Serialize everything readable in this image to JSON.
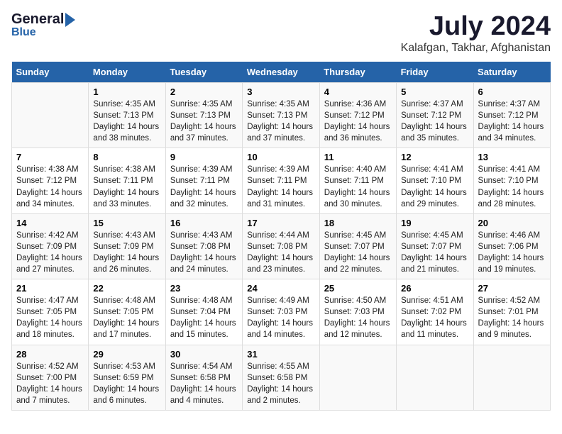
{
  "header": {
    "logo_general": "General",
    "logo_blue": "Blue",
    "title": "July 2024",
    "subtitle": "Kalafgan, Takhar, Afghanistan"
  },
  "days_of_week": [
    "Sunday",
    "Monday",
    "Tuesday",
    "Wednesday",
    "Thursday",
    "Friday",
    "Saturday"
  ],
  "weeks": [
    [
      {
        "day": "",
        "content": ""
      },
      {
        "day": "1",
        "content": "Sunrise: 4:35 AM\nSunset: 7:13 PM\nDaylight: 14 hours\nand 38 minutes."
      },
      {
        "day": "2",
        "content": "Sunrise: 4:35 AM\nSunset: 7:13 PM\nDaylight: 14 hours\nand 37 minutes."
      },
      {
        "day": "3",
        "content": "Sunrise: 4:35 AM\nSunset: 7:13 PM\nDaylight: 14 hours\nand 37 minutes."
      },
      {
        "day": "4",
        "content": "Sunrise: 4:36 AM\nSunset: 7:12 PM\nDaylight: 14 hours\nand 36 minutes."
      },
      {
        "day": "5",
        "content": "Sunrise: 4:37 AM\nSunset: 7:12 PM\nDaylight: 14 hours\nand 35 minutes."
      },
      {
        "day": "6",
        "content": "Sunrise: 4:37 AM\nSunset: 7:12 PM\nDaylight: 14 hours\nand 34 minutes."
      }
    ],
    [
      {
        "day": "7",
        "content": "Sunrise: 4:38 AM\nSunset: 7:12 PM\nDaylight: 14 hours\nand 34 minutes."
      },
      {
        "day": "8",
        "content": "Sunrise: 4:38 AM\nSunset: 7:11 PM\nDaylight: 14 hours\nand 33 minutes."
      },
      {
        "day": "9",
        "content": "Sunrise: 4:39 AM\nSunset: 7:11 PM\nDaylight: 14 hours\nand 32 minutes."
      },
      {
        "day": "10",
        "content": "Sunrise: 4:39 AM\nSunset: 7:11 PM\nDaylight: 14 hours\nand 31 minutes."
      },
      {
        "day": "11",
        "content": "Sunrise: 4:40 AM\nSunset: 7:11 PM\nDaylight: 14 hours\nand 30 minutes."
      },
      {
        "day": "12",
        "content": "Sunrise: 4:41 AM\nSunset: 7:10 PM\nDaylight: 14 hours\nand 29 minutes."
      },
      {
        "day": "13",
        "content": "Sunrise: 4:41 AM\nSunset: 7:10 PM\nDaylight: 14 hours\nand 28 minutes."
      }
    ],
    [
      {
        "day": "14",
        "content": "Sunrise: 4:42 AM\nSunset: 7:09 PM\nDaylight: 14 hours\nand 27 minutes."
      },
      {
        "day": "15",
        "content": "Sunrise: 4:43 AM\nSunset: 7:09 PM\nDaylight: 14 hours\nand 26 minutes."
      },
      {
        "day": "16",
        "content": "Sunrise: 4:43 AM\nSunset: 7:08 PM\nDaylight: 14 hours\nand 24 minutes."
      },
      {
        "day": "17",
        "content": "Sunrise: 4:44 AM\nSunset: 7:08 PM\nDaylight: 14 hours\nand 23 minutes."
      },
      {
        "day": "18",
        "content": "Sunrise: 4:45 AM\nSunset: 7:07 PM\nDaylight: 14 hours\nand 22 minutes."
      },
      {
        "day": "19",
        "content": "Sunrise: 4:45 AM\nSunset: 7:07 PM\nDaylight: 14 hours\nand 21 minutes."
      },
      {
        "day": "20",
        "content": "Sunrise: 4:46 AM\nSunset: 7:06 PM\nDaylight: 14 hours\nand 19 minutes."
      }
    ],
    [
      {
        "day": "21",
        "content": "Sunrise: 4:47 AM\nSunset: 7:05 PM\nDaylight: 14 hours\nand 18 minutes."
      },
      {
        "day": "22",
        "content": "Sunrise: 4:48 AM\nSunset: 7:05 PM\nDaylight: 14 hours\nand 17 minutes."
      },
      {
        "day": "23",
        "content": "Sunrise: 4:48 AM\nSunset: 7:04 PM\nDaylight: 14 hours\nand 15 minutes."
      },
      {
        "day": "24",
        "content": "Sunrise: 4:49 AM\nSunset: 7:03 PM\nDaylight: 14 hours\nand 14 minutes."
      },
      {
        "day": "25",
        "content": "Sunrise: 4:50 AM\nSunset: 7:03 PM\nDaylight: 14 hours\nand 12 minutes."
      },
      {
        "day": "26",
        "content": "Sunrise: 4:51 AM\nSunset: 7:02 PM\nDaylight: 14 hours\nand 11 minutes."
      },
      {
        "day": "27",
        "content": "Sunrise: 4:52 AM\nSunset: 7:01 PM\nDaylight: 14 hours\nand 9 minutes."
      }
    ],
    [
      {
        "day": "28",
        "content": "Sunrise: 4:52 AM\nSunset: 7:00 PM\nDaylight: 14 hours\nand 7 minutes."
      },
      {
        "day": "29",
        "content": "Sunrise: 4:53 AM\nSunset: 6:59 PM\nDaylight: 14 hours\nand 6 minutes."
      },
      {
        "day": "30",
        "content": "Sunrise: 4:54 AM\nSunset: 6:58 PM\nDaylight: 14 hours\nand 4 minutes."
      },
      {
        "day": "31",
        "content": "Sunrise: 4:55 AM\nSunset: 6:58 PM\nDaylight: 14 hours\nand 2 minutes."
      },
      {
        "day": "",
        "content": ""
      },
      {
        "day": "",
        "content": ""
      },
      {
        "day": "",
        "content": ""
      }
    ]
  ]
}
